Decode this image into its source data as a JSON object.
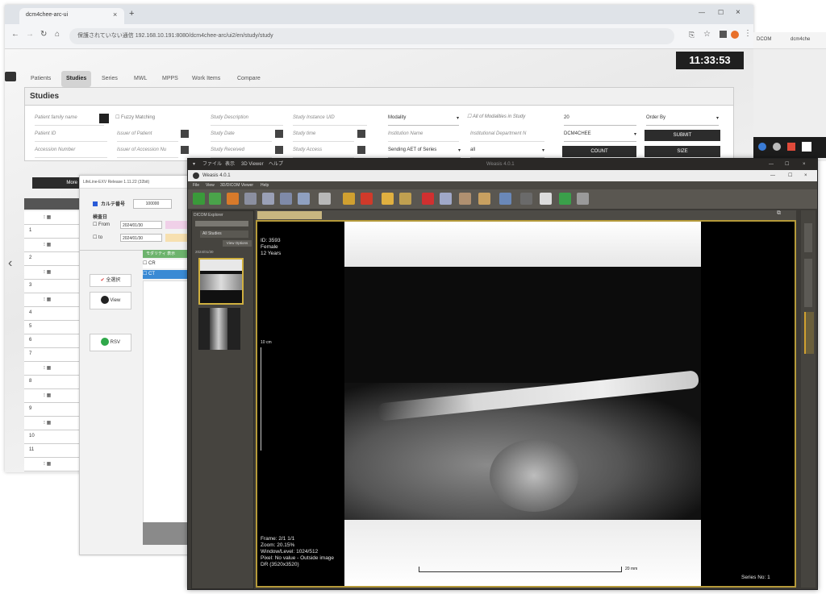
{
  "browser": {
    "tab_title": "dcm4chee-arc-ui",
    "address": "保護されていない通信   192.168.10.191:8080/dcm4chee-arc/ui2/en/study/study",
    "bookmarks": [
      "DCOM",
      "dcm4che"
    ]
  },
  "app": {
    "clock": "11:33:53",
    "nav_tabs": [
      "Patients",
      "Studies",
      "Series",
      "MWL",
      "MPPS",
      "Work Items",
      "Compare"
    ],
    "active_tab": "Studies",
    "panel_title": "Studies",
    "filters": {
      "patient_family_name": "Patient family name",
      "fuzzy_matching": "Fuzzy Matching",
      "patient_id": "Patient ID",
      "issuer_of_patient": "Issuer of Patient",
      "accession_number": "Accession Number",
      "issuer_of_accession": "Issuer of Accession Nu",
      "study_description": "Study Description",
      "study_instance_uid": "Study Instance UID",
      "study_date": "Study Date",
      "study_time": "Study time",
      "study_received": "Study Received",
      "study_access": "Study Access",
      "modality": "Modality",
      "all_modalities": "All of Modalities in Study",
      "institution_name": "Institution Name",
      "institutional_department": "Institutional Department N",
      "sending_aet": "Sending AET of Series",
      "sending_value": "all",
      "limit": "20",
      "order_by": "Order By",
      "aet": "DCM4CHEE",
      "submit": "SUBMIT",
      "count": "COUNT",
      "size": "SIZE"
    },
    "more_label": "More",
    "row_numbers": [
      "1",
      "2",
      "3",
      "4",
      "5",
      "6",
      "7",
      "8",
      "9",
      "10",
      "11"
    ]
  },
  "dialog": {
    "title": "LifeLine-EXV  Release 1.11.22 (32bit)",
    "karte_label": "カルテ番号",
    "karte_value": "100000",
    "date_label": "検査日",
    "from_label": "From",
    "to_label": "to",
    "from_date": "2024/01/30",
    "to_date": "2024/01/30",
    "list_header": "モダリティ 表示",
    "modalities": [
      "CR",
      "CT"
    ],
    "btn_all_clear": "全選択",
    "btn_view": "View",
    "btn_rsv": "RSV"
  },
  "viewer": {
    "title": "Weasis 4.0.1",
    "menu_jp": [
      "ファイル",
      "表示",
      "3D Viewer",
      "ヘルプ"
    ],
    "menu_en": [
      "File",
      "View",
      "3D/DICOM Viewer",
      "Help"
    ],
    "explorer_title": "DICOM Explorer",
    "all_studies": "All Studies",
    "view_options": "View Options",
    "series_header": "2024/01/30",
    "overlay_top": [
      "ID: 3593",
      "Female",
      "12 Years"
    ],
    "scale_top": "10 cm",
    "overlay_bottom": [
      "Frame: 2/1 1/1",
      "Zoom: 20.15%",
      "Window/Level: 1024/512",
      "Pixel: No value - Outside image",
      "DR (3520x3520)"
    ],
    "scale_bottom": "20 mm",
    "series_no": "Series No: 1"
  }
}
